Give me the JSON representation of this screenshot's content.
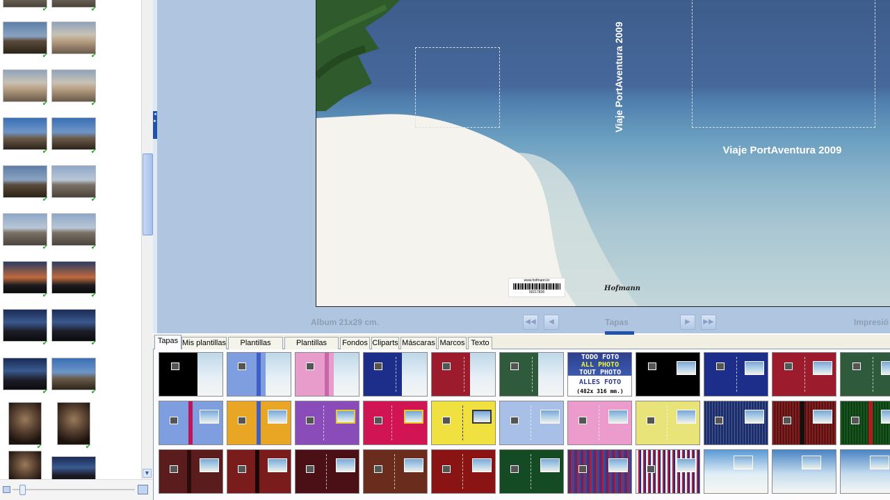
{
  "canvas": {
    "album_label": "Album 21x29 cm.",
    "section_label": "Tapas",
    "print_label": "Impresió",
    "spine_text": "Viaje PortAventura 2009",
    "cover_title": "Viaje PortAventura 2009",
    "barcode_url": "www.hofmann.kr",
    "barcode_number": "00217836",
    "brand": "Hofmann"
  },
  "tabs": [
    {
      "label": "Tapas",
      "active": true
    },
    {
      "label": "Mis plantillas"
    },
    {
      "label": "Plantillas página"
    },
    {
      "label": "Plantillas dobles"
    },
    {
      "label": "Fondos"
    },
    {
      "label": "Cliparts"
    },
    {
      "label": "Máscaras"
    },
    {
      "label": "Marcos"
    },
    {
      "label": "Texto"
    }
  ],
  "gallery": {
    "all_photo_lines": [
      "TODO FOTO",
      "ALL PHOTO",
      "TOUT PHOTO",
      "ALLES FOTO",
      "(482x 316 mm.)"
    ]
  },
  "colors": {
    "accent": "#2452a8",
    "canvas_bg": "#b0c6e0",
    "check": "#2aa52a"
  },
  "icons": {
    "first_page": "first-page-icon",
    "prev_page": "prev-page-icon",
    "next_page": "next-page-icon",
    "last_page": "last-page-icon",
    "check": "check-icon"
  }
}
